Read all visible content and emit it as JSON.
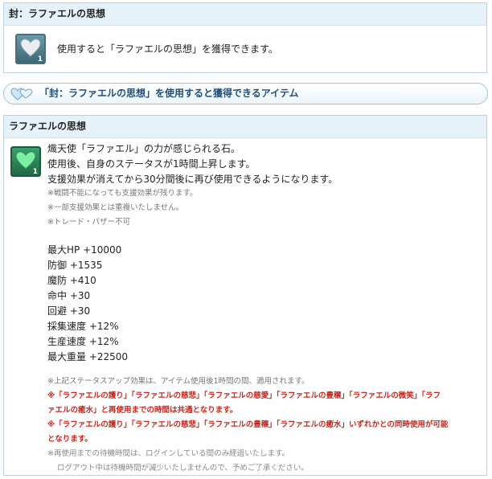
{
  "top_box": {
    "title": "封：ラファエルの思想",
    "description": "使用すると「ラファエルの思想」を獲得できます。",
    "icon": "gray-heart-icon",
    "icon_count": "1"
  },
  "banner": {
    "icon": "double-heart-icon",
    "text": "「封：ラファエルの思想」を使用すると獲得できるアイテム"
  },
  "item_box": {
    "title": "ラファエルの思想",
    "icon": "green-heart-icon",
    "icon_count": "1",
    "desc_lines": [
      "熾天使「ラファエル」の力が感じられる石。",
      "使用後、自身のステータスが1時間上昇します。",
      "支援効果が消えてから30分間後に再び使用できるようになります。"
    ],
    "notes": [
      "※戦闘不能になっても支援効果が残ります。",
      "※一部支援効果とは重複いたしません。",
      "※トレード・バザー不可"
    ],
    "stats": [
      "最大HP +10000",
      "防御 +1535",
      "魔防 +410",
      "命中 +30",
      "回避 +30",
      "採集速度 +12%",
      "生産速度 +12%",
      "最大重量 +22500"
    ],
    "footer_note1": "※上記ステータスアップ効果は、アイテム使用後1時間の間、適用されます。",
    "red1_line1": "※「ラファエルの護り」「ラファエルの慈悲」「ラファエルの慈愛」「ラファエルの豊穣」「ラファエルの微笑」「ラフ",
    "red1_line2": "ァエルの癒水」と再使用までの時間は共通となります。",
    "red2_line1": "※「ラファエルの護り」「ラファエルの慈悲」「ラファエルの豊穣」「ラファエルの癒水」いずれかとの同時使用が可能",
    "red2_line2": "となります。",
    "footer_note2_line1": "※再使用までの待機時間は、ログインしている間のみ経過いたします。",
    "footer_note2_line2": "ログアウト中は待機時間が減少いたしませんので、予めご了承ください。"
  }
}
